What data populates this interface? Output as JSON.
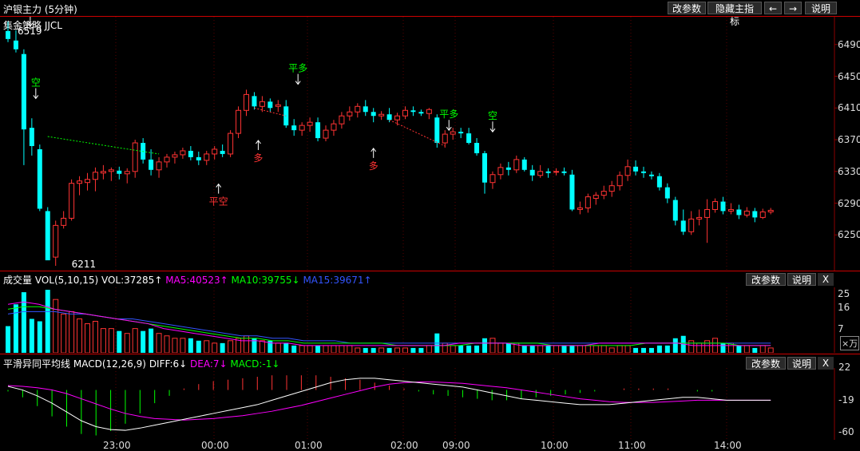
{
  "header": {
    "title": "沪银主力 (5分钟)",
    "buttons": [
      "改参数",
      "隐藏主指标",
      "←",
      "→",
      "说明"
    ],
    "strategy_label": "集金策略 JJCL"
  },
  "main_chart": {
    "y_ticks": [
      "6490",
      "6450",
      "6410",
      "6370",
      "6330",
      "6290",
      "6250"
    ],
    "high_label": "6519",
    "low_label": "6211",
    "signals": [
      "平多",
      "空",
      "平多",
      "多",
      "平空",
      "多",
      "平多",
      "空"
    ]
  },
  "volume_panel": {
    "label": "成交量",
    "indicator": "VOL(5,10,15)",
    "vol": "VOL:37285↑",
    "ma5": "MA5:40523↑",
    "ma10": "MA10:39755↓",
    "ma15": "MA15:39671↑",
    "buttons": [
      "改参数",
      "说明",
      "X"
    ],
    "y_ticks": [
      "25",
      "16",
      "7"
    ],
    "unit": "×万"
  },
  "macd_panel": {
    "label": "平滑异同平均线",
    "indicator": "MACD(12,26,9)",
    "diff": "DIFF:6↓",
    "dea": "DEA:7↓",
    "macd": "MACD:-1↓",
    "buttons": [
      "改参数",
      "说明",
      "X"
    ],
    "y_ticks": [
      "22",
      "-19",
      "-60"
    ]
  },
  "time_axis": [
    "23:00",
    "00:00",
    "01:00",
    "02:00",
    "09:00",
    "10:00",
    "11:00",
    "14:00"
  ],
  "colors": {
    "up": "#ff3333",
    "down": "#00ffff",
    "ma5": "#ff00ff",
    "ma10": "#00ff00",
    "ma15": "#3355ff",
    "grid": "#8b0000"
  },
  "chart_data": {
    "type": "candlestick",
    "ylim": [
      6205,
      6525
    ],
    "candles": [
      [
        6507,
        6519,
        6493,
        6497
      ],
      [
        6495,
        6508,
        6480,
        6484
      ],
      [
        6478,
        6484,
        6338,
        6383
      ],
      [
        6385,
        6397,
        6350,
        6362
      ],
      [
        6358,
        6364,
        6280,
        6283
      ],
      [
        6280,
        6285,
        6225,
        6218
      ],
      [
        6222,
        6268,
        6211,
        6262
      ],
      [
        6262,
        6280,
        6258,
        6271
      ],
      [
        6271,
        6320,
        6268,
        6315
      ],
      [
        6315,
        6324,
        6300,
        6318
      ],
      [
        6316,
        6328,
        6306,
        6320
      ],
      [
        6320,
        6335,
        6305,
        6329
      ],
      [
        6328,
        6338,
        6320,
        6330
      ],
      [
        6330,
        6335,
        6318,
        6332
      ],
      [
        6331,
        6336,
        6320,
        6327
      ],
      [
        6327,
        6334,
        6315,
        6330
      ],
      [
        6330,
        6370,
        6322,
        6366
      ],
      [
        6366,
        6372,
        6340,
        6345
      ],
      [
        6345,
        6358,
        6325,
        6332
      ],
      [
        6332,
        6348,
        6322,
        6342
      ],
      [
        6342,
        6352,
        6335,
        6348
      ],
      [
        6348,
        6355,
        6340,
        6351
      ],
      [
        6351,
        6360,
        6346,
        6356
      ],
      [
        6356,
        6362,
        6344,
        6348
      ],
      [
        6348,
        6355,
        6338,
        6344
      ],
      [
        6344,
        6356,
        6338,
        6352
      ],
      [
        6352,
        6362,
        6345,
        6358
      ],
      [
        6356,
        6364,
        6348,
        6352
      ],
      [
        6352,
        6382,
        6348,
        6378
      ],
      [
        6378,
        6412,
        6372,
        6407
      ],
      [
        6407,
        6433,
        6400,
        6427
      ],
      [
        6425,
        6430,
        6408,
        6412
      ],
      [
        6412,
        6425,
        6405,
        6418
      ],
      [
        6418,
        6422,
        6405,
        6410
      ],
      [
        6412,
        6420,
        6405,
        6414
      ],
      [
        6412,
        6420,
        6385,
        6388
      ],
      [
        6388,
        6396,
        6375,
        6382
      ],
      [
        6382,
        6392,
        6375,
        6388
      ],
      [
        6388,
        6398,
        6380,
        6392
      ],
      [
        6392,
        6398,
        6368,
        6372
      ],
      [
        6372,
        6388,
        6368,
        6382
      ],
      [
        6382,
        6395,
        6375,
        6390
      ],
      [
        6390,
        6405,
        6384,
        6400
      ],
      [
        6400,
        6412,
        6394,
        6405
      ],
      [
        6405,
        6416,
        6398,
        6412
      ],
      [
        6412,
        6420,
        6400,
        6405
      ],
      [
        6405,
        6410,
        6392,
        6400
      ],
      [
        6400,
        6406,
        6395,
        6402
      ],
      [
        6402,
        6410,
        6392,
        6395
      ],
      [
        6395,
        6404,
        6388,
        6400
      ],
      [
        6400,
        6412,
        6396,
        6407
      ],
      [
        6407,
        6412,
        6400,
        6405
      ],
      [
        6405,
        6408,
        6400,
        6403
      ],
      [
        6403,
        6410,
        6396,
        6408
      ],
      [
        6398,
        6402,
        6360,
        6366
      ],
      [
        6366,
        6382,
        6360,
        6377
      ],
      [
        6377,
        6385,
        6370,
        6380
      ],
      [
        6380,
        6385,
        6372,
        6378
      ],
      [
        6378,
        6385,
        6364,
        6366
      ],
      [
        6366,
        6372,
        6350,
        6353
      ],
      [
        6353,
        6356,
        6302,
        6316
      ],
      [
        6316,
        6330,
        6308,
        6326
      ],
      [
        6326,
        6340,
        6320,
        6335
      ],
      [
        6335,
        6342,
        6325,
        6332
      ],
      [
        6332,
        6350,
        6328,
        6345
      ],
      [
        6345,
        6348,
        6330,
        6332
      ],
      [
        6332,
        6338,
        6318,
        6325
      ],
      [
        6325,
        6338,
        6322,
        6330
      ],
      [
        6330,
        6334,
        6322,
        6328
      ],
      [
        6330,
        6334,
        6325,
        6330
      ],
      [
        6330,
        6335,
        6325,
        6328
      ],
      [
        6326,
        6332,
        6280,
        6282
      ],
      [
        6282,
        6292,
        6276,
        6284
      ],
      [
        6284,
        6302,
        6278,
        6298
      ],
      [
        6296,
        6304,
        6288,
        6300
      ],
      [
        6300,
        6312,
        6295,
        6305
      ],
      [
        6305,
        6318,
        6298,
        6312
      ],
      [
        6312,
        6330,
        6306,
        6325
      ],
      [
        6325,
        6345,
        6318,
        6336
      ],
      [
        6336,
        6344,
        6325,
        6330
      ],
      [
        6330,
        6336,
        6322,
        6328
      ],
      [
        6326,
        6330,
        6320,
        6324
      ],
      [
        6324,
        6328,
        6306,
        6310
      ],
      [
        6310,
        6315,
        6290,
        6296
      ],
      [
        6294,
        6298,
        6262,
        6268
      ],
      [
        6268,
        6282,
        6250,
        6254
      ],
      [
        6254,
        6280,
        6250,
        6270
      ],
      [
        6270,
        6282,
        6262,
        6272
      ],
      [
        6272,
        6295,
        6240,
        6282
      ],
      [
        6282,
        6296,
        6278,
        6292
      ],
      [
        6292,
        6298,
        6276,
        6280
      ],
      [
        6280,
        6290,
        6276,
        6282
      ],
      [
        6282,
        6288,
        6270,
        6275
      ],
      [
        6275,
        6285,
        6272,
        6280
      ],
      [
        6280,
        6284,
        6266,
        6272
      ],
      [
        6272,
        6283,
        6270,
        6279
      ],
      [
        6279,
        6284,
        6276,
        6281
      ]
    ],
    "volume": [
      11,
      20,
      25,
      14,
      13,
      26,
      22,
      16,
      17,
      14,
      12,
      13,
      10,
      10,
      9,
      8,
      10,
      9,
      10,
      8,
      7,
      6,
      6,
      6,
      5,
      5,
      4,
      4,
      5,
      6,
      7,
      6,
      5,
      5,
      4,
      4,
      3,
      3,
      3,
      3,
      3,
      3,
      3,
      3,
      2,
      2,
      2,
      2,
      2,
      2,
      2,
      2,
      2,
      3,
      8,
      4,
      3,
      3,
      3,
      3,
      6,
      6,
      4,
      4,
      4,
      3,
      3,
      3,
      3,
      3,
      3,
      3,
      3,
      3,
      3,
      3,
      2,
      3,
      3,
      2,
      2,
      2,
      3,
      3,
      6,
      7,
      5,
      4,
      5,
      6,
      4,
      4,
      3,
      3,
      2,
      3,
      2
    ],
    "volume_ma": {
      "ma5": [
        20,
        21,
        20,
        18,
        17,
        16,
        15,
        14,
        13,
        12,
        10,
        9,
        8,
        7,
        6,
        5,
        5,
        4,
        4,
        3,
        3,
        3,
        3,
        3,
        3,
        3,
        3,
        3,
        3,
        4,
        4,
        4,
        4,
        3,
        3,
        3,
        3,
        3,
        4,
        4,
        4,
        4,
        4,
        4,
        3,
        3,
        3,
        3,
        3,
        3
      ],
      "ma10": [
        18,
        19,
        19,
        18,
        17,
        16,
        15,
        14,
        13,
        12,
        11,
        10,
        9,
        8,
        7,
        6,
        6,
        5,
        5,
        4,
        4,
        4,
        4,
        4,
        4,
        3,
        3,
        3,
        3,
        3,
        4,
        4,
        4,
        4,
        4,
        3,
        3,
        3,
        3,
        3,
        3,
        4,
        4,
        4,
        4,
        4,
        4,
        3,
        3,
        3
      ],
      "ma15": [
        16,
        17,
        17,
        17,
        16,
        16,
        15,
        14,
        14,
        13,
        12,
        11,
        10,
        9,
        8,
        7,
        7,
        6,
        6,
        5,
        5,
        5,
        4,
        4,
        4,
        4,
        4,
        4,
        4,
        4,
        4,
        4,
        4,
        4,
        4,
        4,
        4,
        4,
        4,
        4,
        4,
        4,
        4,
        4,
        4,
        4,
        4,
        4,
        4,
        4
      ]
    },
    "macd": {
      "diff": [
        5,
        0,
        -8,
        -18,
        -30,
        -42,
        -50,
        -54,
        -55,
        -52,
        -48,
        -44,
        -40,
        -36,
        -32,
        -28,
        -24,
        -20,
        -14,
        -8,
        -2,
        4,
        10,
        14,
        16,
        16,
        14,
        12,
        10,
        8,
        6,
        4,
        0,
        -4,
        -8,
        -12,
        -14,
        -16,
        -18,
        -20,
        -20,
        -20,
        -18,
        -16,
        -14,
        -12,
        -10,
        -10,
        -12,
        -14,
        -14,
        -14,
        -14
      ],
      "dea": [
        6,
        5,
        3,
        0,
        -5,
        -12,
        -19,
        -26,
        -32,
        -36,
        -39,
        -40,
        -41,
        -40,
        -39,
        -37,
        -35,
        -32,
        -29,
        -25,
        -21,
        -16,
        -11,
        -6,
        -1,
        4,
        8,
        10,
        11,
        11,
        10,
        9,
        7,
        5,
        3,
        0,
        -3,
        -6,
        -9,
        -12,
        -14,
        -16,
        -17,
        -17,
        -17,
        -16,
        -15,
        -14,
        -14,
        -14,
        -14,
        -14,
        -14
      ],
      "hist": [
        -2,
        -10,
        -22,
        -36,
        -50,
        -60,
        -62,
        -56,
        -46,
        -32,
        -18,
        -8,
        2,
        8,
        12,
        14,
        16,
        18,
        20,
        20,
        20,
        20,
        18,
        16,
        14,
        10,
        6,
        2,
        -2,
        -6,
        -8,
        -10,
        -12,
        -14,
        -14,
        -12,
        -10,
        -8,
        -6,
        -4,
        -2,
        0,
        2,
        2,
        2,
        2,
        0,
        -2,
        -2,
        0,
        0,
        0,
        0
      ]
    }
  }
}
